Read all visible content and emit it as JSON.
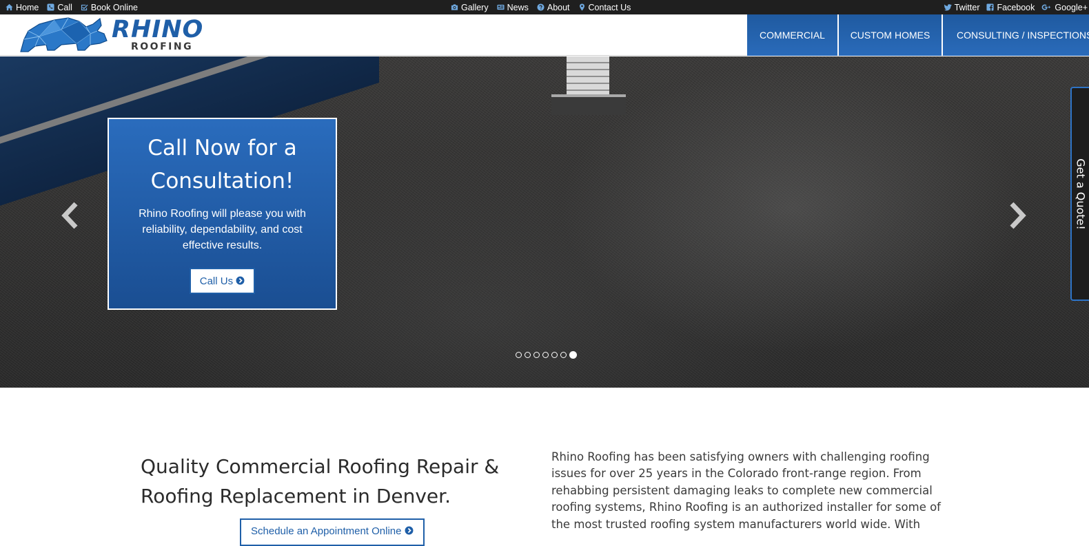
{
  "topbar": {
    "left": [
      {
        "label": "Home",
        "icon": "home-icon"
      },
      {
        "label": "Call",
        "icon": "phone-icon"
      },
      {
        "label": "Book Online",
        "icon": "check-square-icon"
      }
    ],
    "center": [
      {
        "label": "Gallery",
        "icon": "camera-icon"
      },
      {
        "label": "News",
        "icon": "newspaper-icon"
      },
      {
        "label": "About",
        "icon": "question-circle-icon"
      },
      {
        "label": "Contact Us",
        "icon": "map-marker-icon"
      }
    ],
    "right": [
      {
        "label": "Twitter",
        "icon": "twitter-icon"
      },
      {
        "label": "Facebook",
        "icon": "facebook-icon"
      },
      {
        "label": "Google+",
        "icon": "google-plus-icon"
      }
    ]
  },
  "logo": {
    "name": "RHINO",
    "sub": "ROOFING"
  },
  "nav": [
    "COMMERCIAL",
    "CUSTOM HOMES",
    "CONSULTING / INSPECTIONS"
  ],
  "hero": {
    "title": "Call Now for a Consultation!",
    "text": "Rhino Roofing will please you with reliability, dependability, and cost effective results.",
    "button": "Call Us",
    "slide_count": 7,
    "active_slide": 7,
    "quote_tab": "Get a Quote!"
  },
  "section": {
    "title": "Quality Commercial Roofing Repair & Roofing Replacement in Denver.",
    "button": "Schedule an Appointment Online",
    "text": "Rhino Roofing has been satisfying owners with challenging roofing issues for over 25 years in the Colorado front-range region. From rehabbing persistent damaging leaks to complete new commercial roofing systems, Rhino Roofing is an authorized installer for some of the most trusted roofing system manufacturers world wide. With"
  },
  "colors": {
    "brand_blue": "#1f5fa8",
    "topbar_bg": "#1f1f1f",
    "icon_blue": "#6fa9e0"
  }
}
